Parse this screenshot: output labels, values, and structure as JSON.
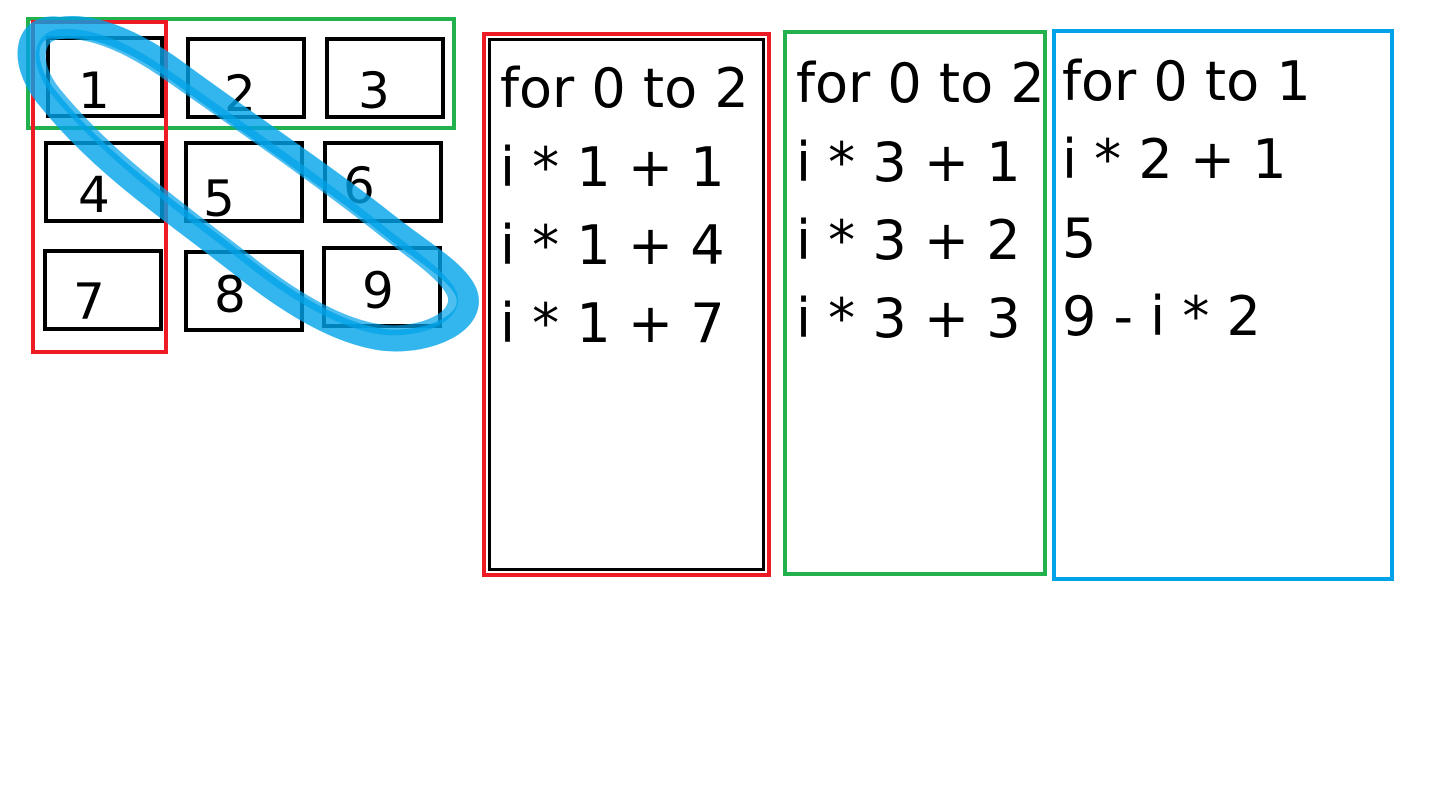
{
  "colors": {
    "row_highlight": "#22b14c",
    "column_highlight": "#ed1c24",
    "diagonal_highlight": "#00a2e8",
    "cell_border": "#000000",
    "text": "#000000"
  },
  "grid": {
    "cells": [
      "1",
      "2",
      "3",
      "4",
      "5",
      "6",
      "7",
      "8",
      "9"
    ]
  },
  "panels": {
    "column": {
      "lines": [
        "for 0 to 2",
        "i * 1 + 1",
        "i * 1 + 4",
        "i * 1 + 7"
      ]
    },
    "row": {
      "lines": [
        "for 0 to 2",
        "i * 3 + 1",
        "i * 3 + 2",
        "i * 3 + 3"
      ]
    },
    "diagonal": {
      "lines": [
        "for 0 to 1",
        "i * 2 + 1",
        "5",
        "9 - i * 2"
      ]
    }
  }
}
